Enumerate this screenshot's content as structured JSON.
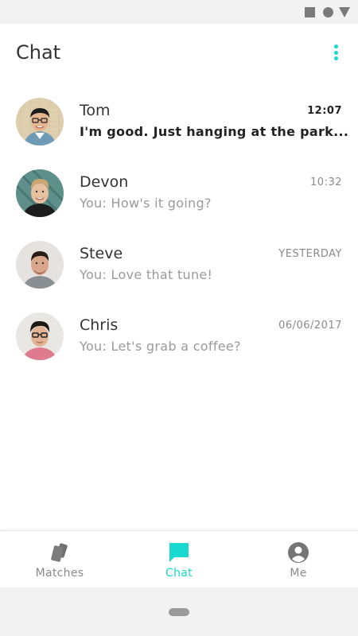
{
  "header": {
    "title": "Chat"
  },
  "chats": [
    {
      "name": "Tom",
      "time": "12:07",
      "preview": "I'm good. Just hanging at the park...",
      "unread": true
    },
    {
      "name": "Devon",
      "time": "10:32",
      "preview": "You: How's it going?",
      "unread": false
    },
    {
      "name": "Steve",
      "time": "YESTERDAY",
      "preview": "You: Love that tune!",
      "unread": false
    },
    {
      "name": "Chris",
      "time": "06/06/2017",
      "preview": "You: Let's grab a coffee?",
      "unread": false
    }
  ],
  "nav": {
    "matches_label": "Matches",
    "chat_label": "Chat",
    "me_label": "Me",
    "active": "chat"
  },
  "colors": {
    "accent": "#17d9d0",
    "inactive": "#8a8a8a",
    "system_bar": "#f2f2f2"
  },
  "icons": {
    "status": [
      "square-icon",
      "circle-icon",
      "triangle-icon"
    ],
    "menu": "more-vertical-icon",
    "matches": "cards-icon",
    "chat": "chat-bubble-icon",
    "me": "account-circle-icon"
  }
}
